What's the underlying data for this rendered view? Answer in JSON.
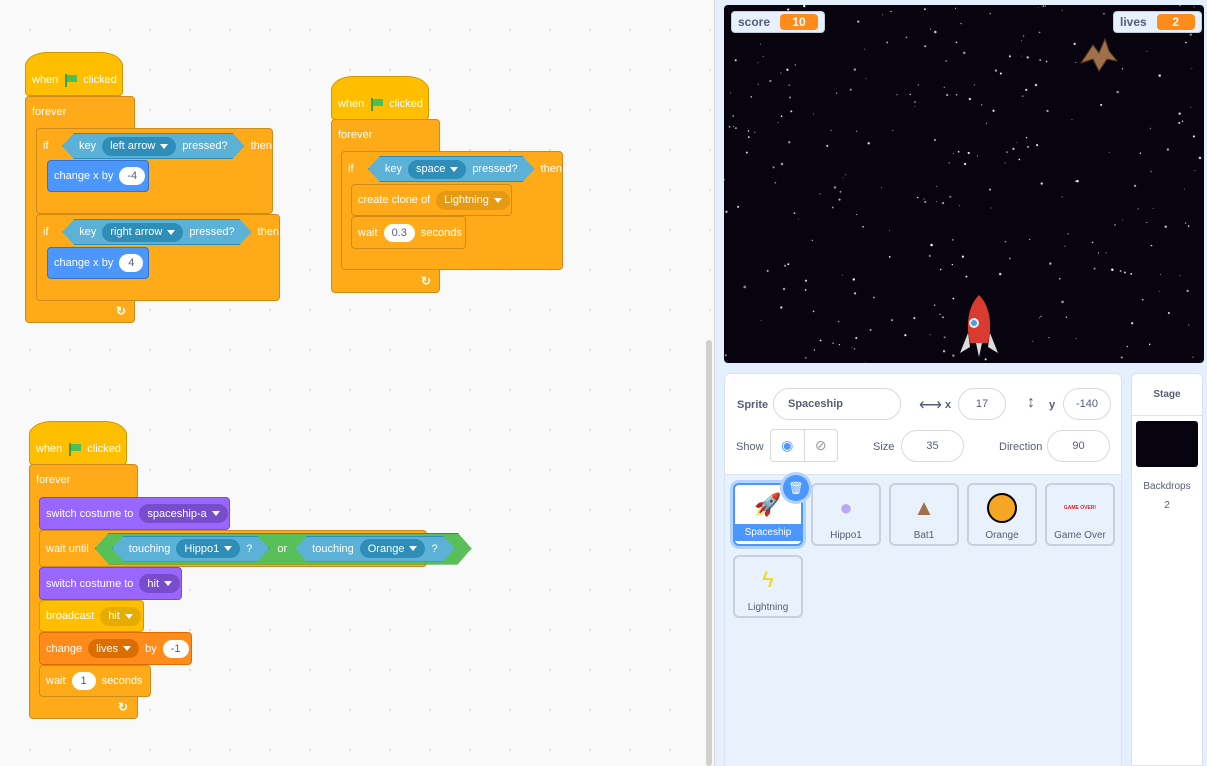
{
  "scripts": [
    {
      "hat": {
        "when": "when",
        "clicked": "clicked"
      },
      "forever": "forever",
      "if1": {
        "if": "if",
        "key": "key",
        "option": "left arrow",
        "pressed": "pressed?",
        "then": "then",
        "action": "change x by",
        "value": "-4"
      },
      "if2": {
        "if": "if",
        "key": "key",
        "option": "right arrow",
        "pressed": "pressed?",
        "then": "then",
        "action": "change x by",
        "value": "4"
      }
    },
    {
      "hat": {
        "when": "when",
        "clicked": "clicked"
      },
      "forever": "forever",
      "if1": {
        "if": "if",
        "key": "key",
        "option": "space",
        "pressed": "pressed?",
        "then": "then"
      },
      "clone": {
        "label": "create clone of",
        "option": "Lightning"
      },
      "wait": {
        "label": "wait",
        "value": "0.3",
        "unit": "seconds"
      }
    },
    {
      "hat": {
        "when": "when",
        "clicked": "clicked"
      },
      "forever": "forever",
      "costume1": {
        "label": "switch costume to",
        "option": "spaceship-a"
      },
      "waituntil": {
        "label": "wait until",
        "touching1": "touching",
        "target1": "Hippo1",
        "q1": "?",
        "or": "or",
        "touching2": "touching",
        "target2": "Orange",
        "q2": "?"
      },
      "costume2": {
        "label": "switch costume to",
        "option": "hit"
      },
      "broadcast": {
        "label": "broadcast",
        "option": "hit"
      },
      "change": {
        "label": "change",
        "option": "lives",
        "by": "by",
        "value": "-1"
      },
      "wait": {
        "label": "wait",
        "value": "1",
        "unit": "seconds"
      }
    }
  ],
  "stage": {
    "monitors": [
      {
        "name": "score",
        "value": "10"
      },
      {
        "name": "lives",
        "value": "2"
      }
    ]
  },
  "sprite_info": {
    "sprite_label": "Sprite",
    "sprite_name": "Spaceship",
    "x_label": "x",
    "x": "17",
    "y_label": "y",
    "y": "-140",
    "show_label": "Show",
    "size_label": "Size",
    "size": "35",
    "direction_label": "Direction",
    "direction": "90"
  },
  "sprites": [
    {
      "name": "Spaceship",
      "selected": true
    },
    {
      "name": "Hippo1"
    },
    {
      "name": "Bat1"
    },
    {
      "name": "Orange"
    },
    {
      "name": "Game Over",
      "thumb_text": "GAME OVER!"
    },
    {
      "name": "Lightning"
    }
  ],
  "stage_panel": {
    "title": "Stage",
    "backdrops_label": "Backdrops",
    "backdrops_count": "2"
  },
  "colors": {
    "events": "#ffbf00",
    "control": "#ffab19",
    "motion": "#4c97ff",
    "looks": "#9966ff",
    "sensing": "#5cb1d6",
    "operators": "#59c059",
    "variables": "#ff8c1a"
  }
}
